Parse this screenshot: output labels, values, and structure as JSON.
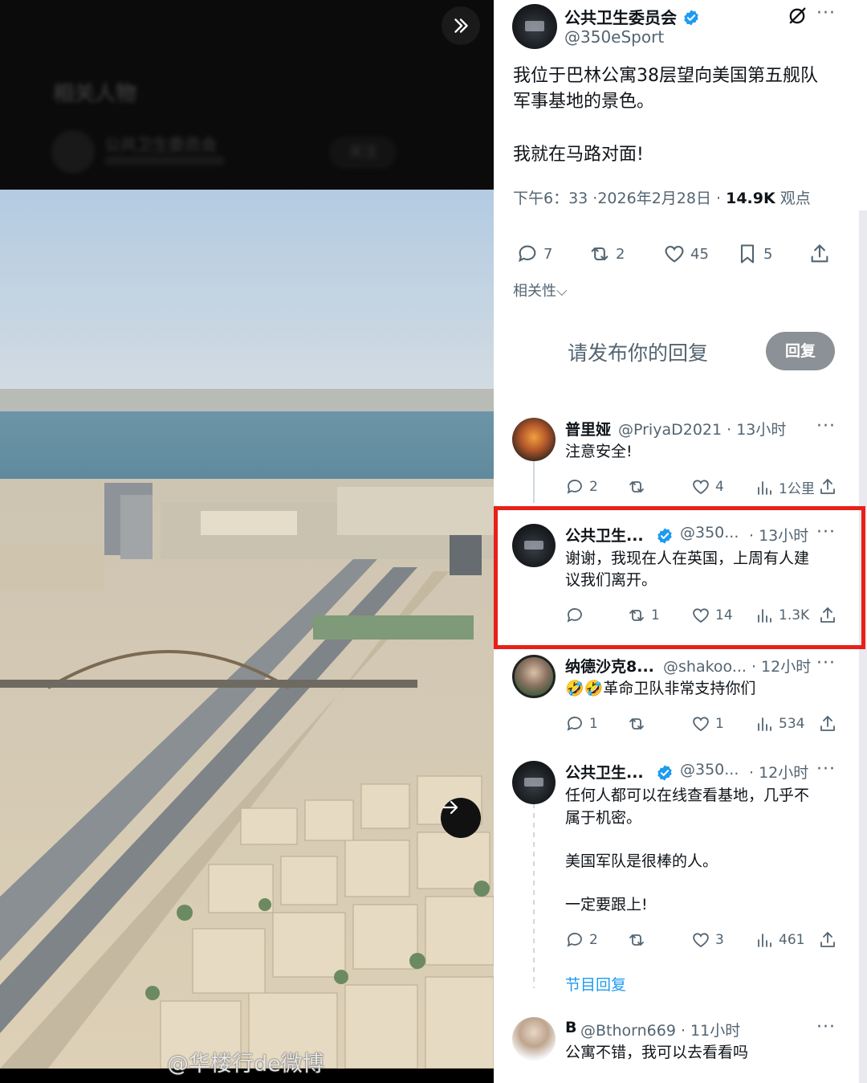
{
  "media": {
    "blurred_title": "相关人物",
    "blurred_name": "公共卫生委员会",
    "blurred_follow": "关注"
  },
  "main_post": {
    "name": "公共卫生委员会",
    "handle": "@350eSport",
    "text_line1": "我位于巴林公寓38层望向美国第五舰队",
    "text_line2": "军事基地的景色。",
    "text_line3": "我就在马路对面!",
    "time_date": "下午6：33 ·2026年2月28日 · ",
    "views_count": "14.9K",
    "views_label": " 观点",
    "replies": "7",
    "reposts": "2",
    "likes": "45",
    "bookmarks": "5"
  },
  "sort": {
    "label": "相关性"
  },
  "composer": {
    "placeholder": "请发布你的回复",
    "button": "回复"
  },
  "replies": [
    {
      "name": "普里娅",
      "handle": "@PriyaD2021 · 13小时",
      "text": "注意安全!",
      "replies": "2",
      "reposts": "",
      "likes": "4",
      "views": "1公里"
    },
    {
      "name": "公共卫生...",
      "handle": "@350...",
      "time": "· 13小时",
      "text1": "谢谢，我现在人在英国，上周有人建",
      "text2": "议我们离开。",
      "replies": "",
      "reposts": "1",
      "likes": "14",
      "views": "1.3K"
    },
    {
      "name": "纳德沙克8...",
      "handle": "@shakoo... · 12小时",
      "text": "🤣🤣革命卫队非常支持你们",
      "replies": "1",
      "reposts": "",
      "likes": "1",
      "views": "534"
    },
    {
      "name": "公共卫生...",
      "handle": "@350...",
      "time": "· 12小时",
      "text1": "任何人都可以在线查看基地，几乎不",
      "text2": "属于机密。",
      "text3": "美国军队是很棒的人。",
      "text4": "一定要跟上!",
      "replies": "2",
      "reposts": "",
      "likes": "3",
      "views": "461"
    },
    {
      "name": "B",
      "handle": "@Bthorn669 · 11小时",
      "text": "公寓不错，我可以去看看吗"
    }
  ],
  "show_replies": "节目回复",
  "watermark": "@华楼行de微博",
  "colors": {
    "accent": "#1d9bf0",
    "highlight": "#e8201a",
    "muted": "#536471"
  }
}
